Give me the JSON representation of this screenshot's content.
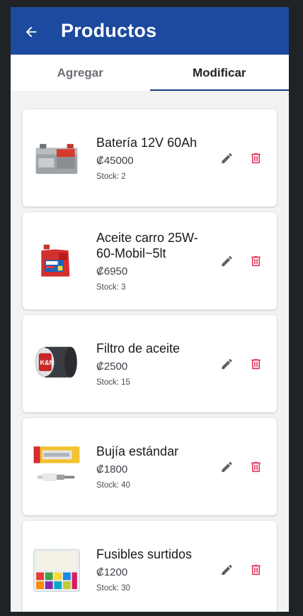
{
  "header": {
    "title": "Productos",
    "back_icon": "arrow-left-icon"
  },
  "tabs": [
    {
      "label": "Agregar",
      "active": false
    },
    {
      "label": "Modificar",
      "active": true
    }
  ],
  "products": [
    {
      "name": "Batería 12V 60Ah",
      "price": "₡45000",
      "stock": "Stock: 2",
      "image": "car-battery"
    },
    {
      "name": "Aceite carro 25W-60-Mobil~5lt",
      "price": "₡6950",
      "stock": "Stock: 3",
      "image": "motor-oil-bottle"
    },
    {
      "name": "Filtro de aceite",
      "price": "₡2500",
      "stock": "Stock: 15",
      "image": "oil-filter"
    },
    {
      "name": "Bujía estándar",
      "price": "₡1800",
      "stock": "Stock: 40",
      "image": "spark-plug"
    },
    {
      "name": "Fusibles surtidos",
      "price": "₡1200",
      "stock": "Stock: 30",
      "image": "fuse-assortment"
    }
  ],
  "colors": {
    "appbar": "#1c4a9e",
    "delete": "#e0345a",
    "edit": "#5b5f66"
  }
}
